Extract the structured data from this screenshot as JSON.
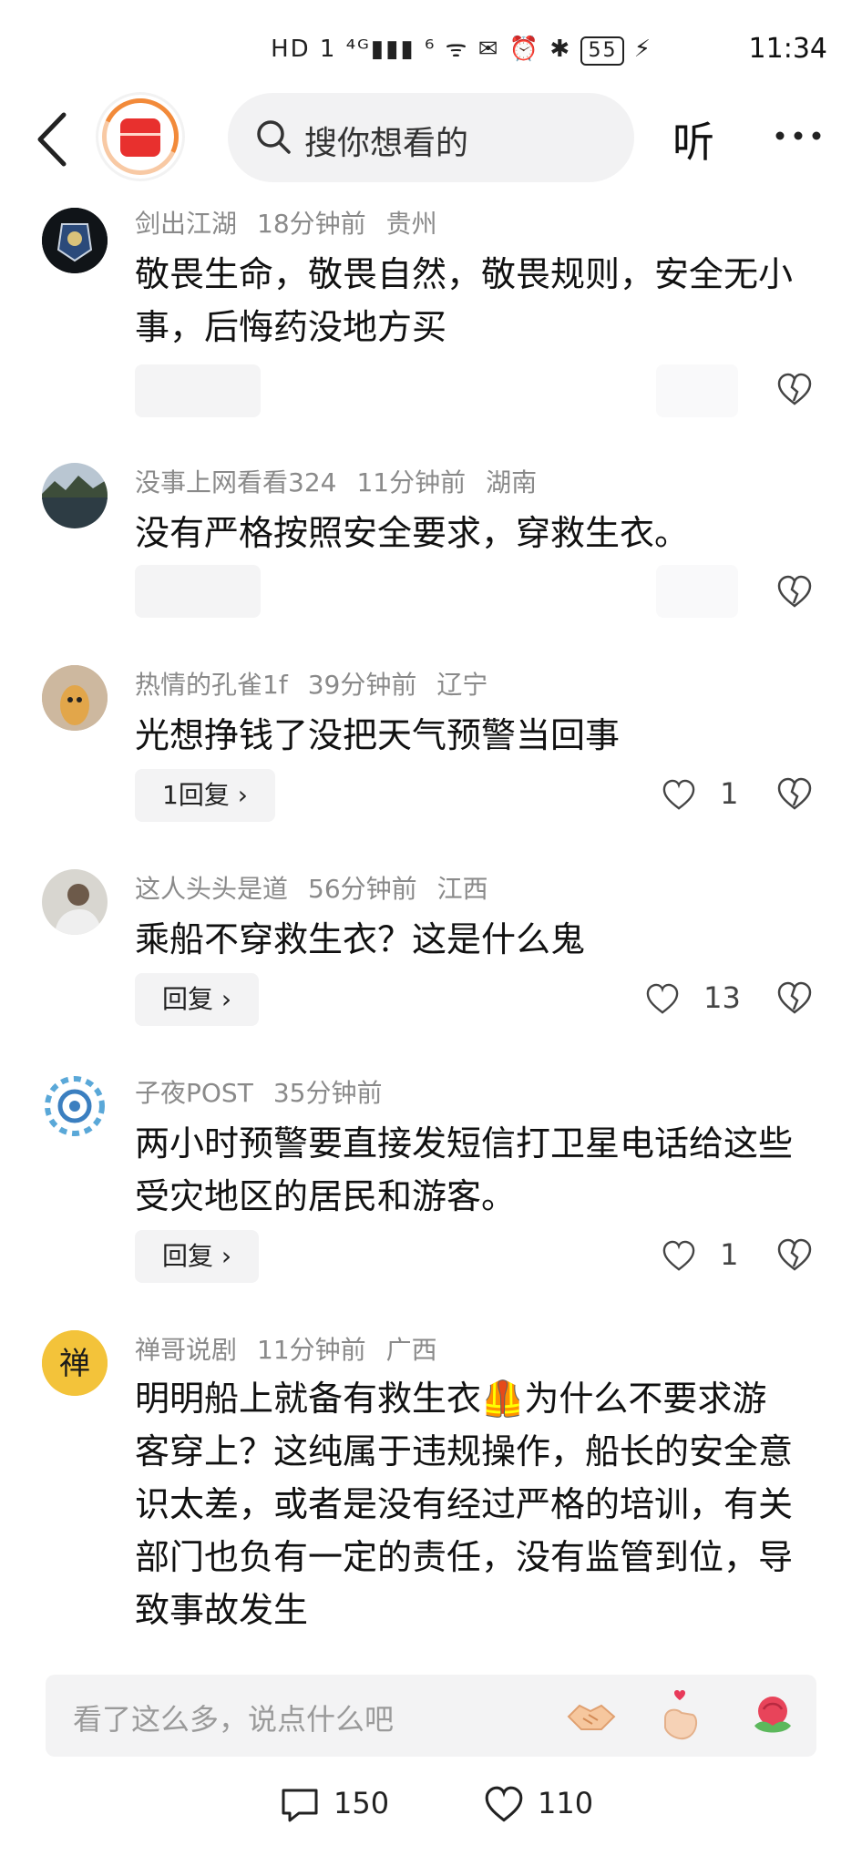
{
  "status_bar": {
    "icons_text": "HD 1 ⁴ᴳ▮▮▮ ⁶ ᯤ",
    "battery": "55",
    "time": "11:34"
  },
  "header": {
    "search_placeholder": "搜你想看的",
    "listen_label": "听"
  },
  "comments": [
    {
      "user": "剑出江湖",
      "time": "18分钟前",
      "location": "贵州",
      "text": "敬畏生命，敬畏自然，敬畏规则，安全无小事，后悔药没地方买",
      "reply": "",
      "likes": ""
    },
    {
      "user": "没事上网看看324",
      "time": "11分钟前",
      "location": "湖南",
      "text": "没有严格按照安全要求，穿救生衣。",
      "reply": "",
      "likes": ""
    },
    {
      "user": "热情的孔雀1f",
      "time": "39分钟前",
      "location": "辽宁",
      "text": "光想挣钱了没把天气预警当回事",
      "reply": "1回复 ›",
      "likes": "1"
    },
    {
      "user": "这人头头是道",
      "time": "56分钟前",
      "location": "江西",
      "text": "乘船不穿救生衣？这是什么鬼",
      "reply": "回复 ›",
      "likes": "13"
    },
    {
      "user": "子夜POST",
      "time": "35分钟前",
      "location": "",
      "text": "两小时预警要直接发短信打卫星电话给这些受灾地区的居民和游客。",
      "reply": "回复 ›",
      "likes": "1"
    },
    {
      "user": "禅哥说剧",
      "time": "11分钟前",
      "location": "广西",
      "text": "明明船上就备有救生衣🦺为什么不要求游客穿上？这纯属于违规操作，船长的安全意识太差，或者是没有经过严格的培训，有关部门也负有一定的责任，没有监管到位，导致事故发生",
      "reply": "",
      "likes": ""
    }
  ],
  "bottom_bar": {
    "placeholder": "看了这么多，说点什么吧",
    "comment_count": "150",
    "like_count": "110"
  },
  "colors": {
    "meta_gray": "#8a8a8a",
    "pill_bg": "#f3f3f4",
    "logo_red": "#e8302e"
  }
}
